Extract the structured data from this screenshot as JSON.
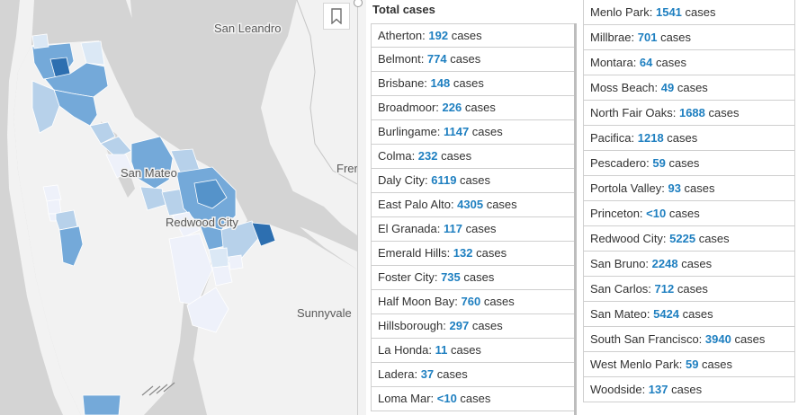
{
  "map": {
    "labels": {
      "san_leandro": "San Leandro",
      "san_mateo": "San Mateo",
      "redwood_city": "Redwood City",
      "fremont_partial": "Frer",
      "sunnyvale": "Sunnyvale"
    },
    "colors": {
      "water": "#d4d4d4",
      "land": "#f2f2f2",
      "light": "#dbe8f5",
      "lighter": "#eef1fa",
      "mid": "#b7d1ea",
      "medium": "#74a9d9",
      "strong": "#5593ca",
      "dark": "#2d6fb0"
    }
  },
  "panel": {
    "title": "Total cases",
    "left_items": [
      {
        "name": "Atherton: ",
        "value": "192",
        "unit": " cases"
      },
      {
        "name": "Belmont: ",
        "value": "774",
        "unit": " cases"
      },
      {
        "name": "Brisbane: ",
        "value": "148",
        "unit": " cases"
      },
      {
        "name": "Broadmoor: ",
        "value": "226",
        "unit": " cases"
      },
      {
        "name": "Burlingame: ",
        "value": "1147",
        "unit": " cases"
      },
      {
        "name": "Colma: ",
        "value": "232",
        "unit": " cases"
      },
      {
        "name": "Daly City: ",
        "value": "6119",
        "unit": " cases"
      },
      {
        "name": "East Palo Alto: ",
        "value": "4305",
        "unit": " cases"
      },
      {
        "name": "El Granada: ",
        "value": "117",
        "unit": " cases"
      },
      {
        "name": "Emerald Hills: ",
        "value": "132",
        "unit": " cases"
      },
      {
        "name": "Foster City: ",
        "value": "735",
        "unit": " cases"
      },
      {
        "name": "Half Moon Bay: ",
        "value": "760",
        "unit": " cases"
      },
      {
        "name": "Hillsborough: ",
        "value": "297",
        "unit": " cases"
      },
      {
        "name": "La Honda: ",
        "value": "11",
        "unit": " cases"
      },
      {
        "name": "Ladera: ",
        "value": "37",
        "unit": " cases"
      },
      {
        "name": "Loma Mar: ",
        "value": "<10",
        "unit": " cases"
      }
    ],
    "right_items": [
      {
        "name": "Menlo Park: ",
        "value": "1541",
        "unit": " cases"
      },
      {
        "name": "Millbrae: ",
        "value": "701",
        "unit": " cases"
      },
      {
        "name": "Montara: ",
        "value": "64",
        "unit": " cases"
      },
      {
        "name": "Moss Beach: ",
        "value": "49",
        "unit": " cases"
      },
      {
        "name": "North Fair Oaks: ",
        "value": "1688",
        "unit": " cases"
      },
      {
        "name": "Pacifica: ",
        "value": "1218",
        "unit": " cases"
      },
      {
        "name": "Pescadero: ",
        "value": "59",
        "unit": " cases"
      },
      {
        "name": "Portola Valley: ",
        "value": "93",
        "unit": " cases"
      },
      {
        "name": "Princeton: ",
        "value": "<10",
        "unit": " cases"
      },
      {
        "name": "Redwood City: ",
        "value": "5225",
        "unit": " cases"
      },
      {
        "name": "San Bruno: ",
        "value": "2248",
        "unit": " cases"
      },
      {
        "name": "San Carlos: ",
        "value": "712",
        "unit": " cases"
      },
      {
        "name": "San Mateo: ",
        "value": "5424",
        "unit": " cases"
      },
      {
        "name": "South San Francisco: ",
        "value": "3940",
        "unit": " cases"
      },
      {
        "name": "West Menlo Park: ",
        "value": "59",
        "unit": " cases"
      },
      {
        "name": "Woodside: ",
        "value": "137",
        "unit": " cases"
      }
    ]
  }
}
